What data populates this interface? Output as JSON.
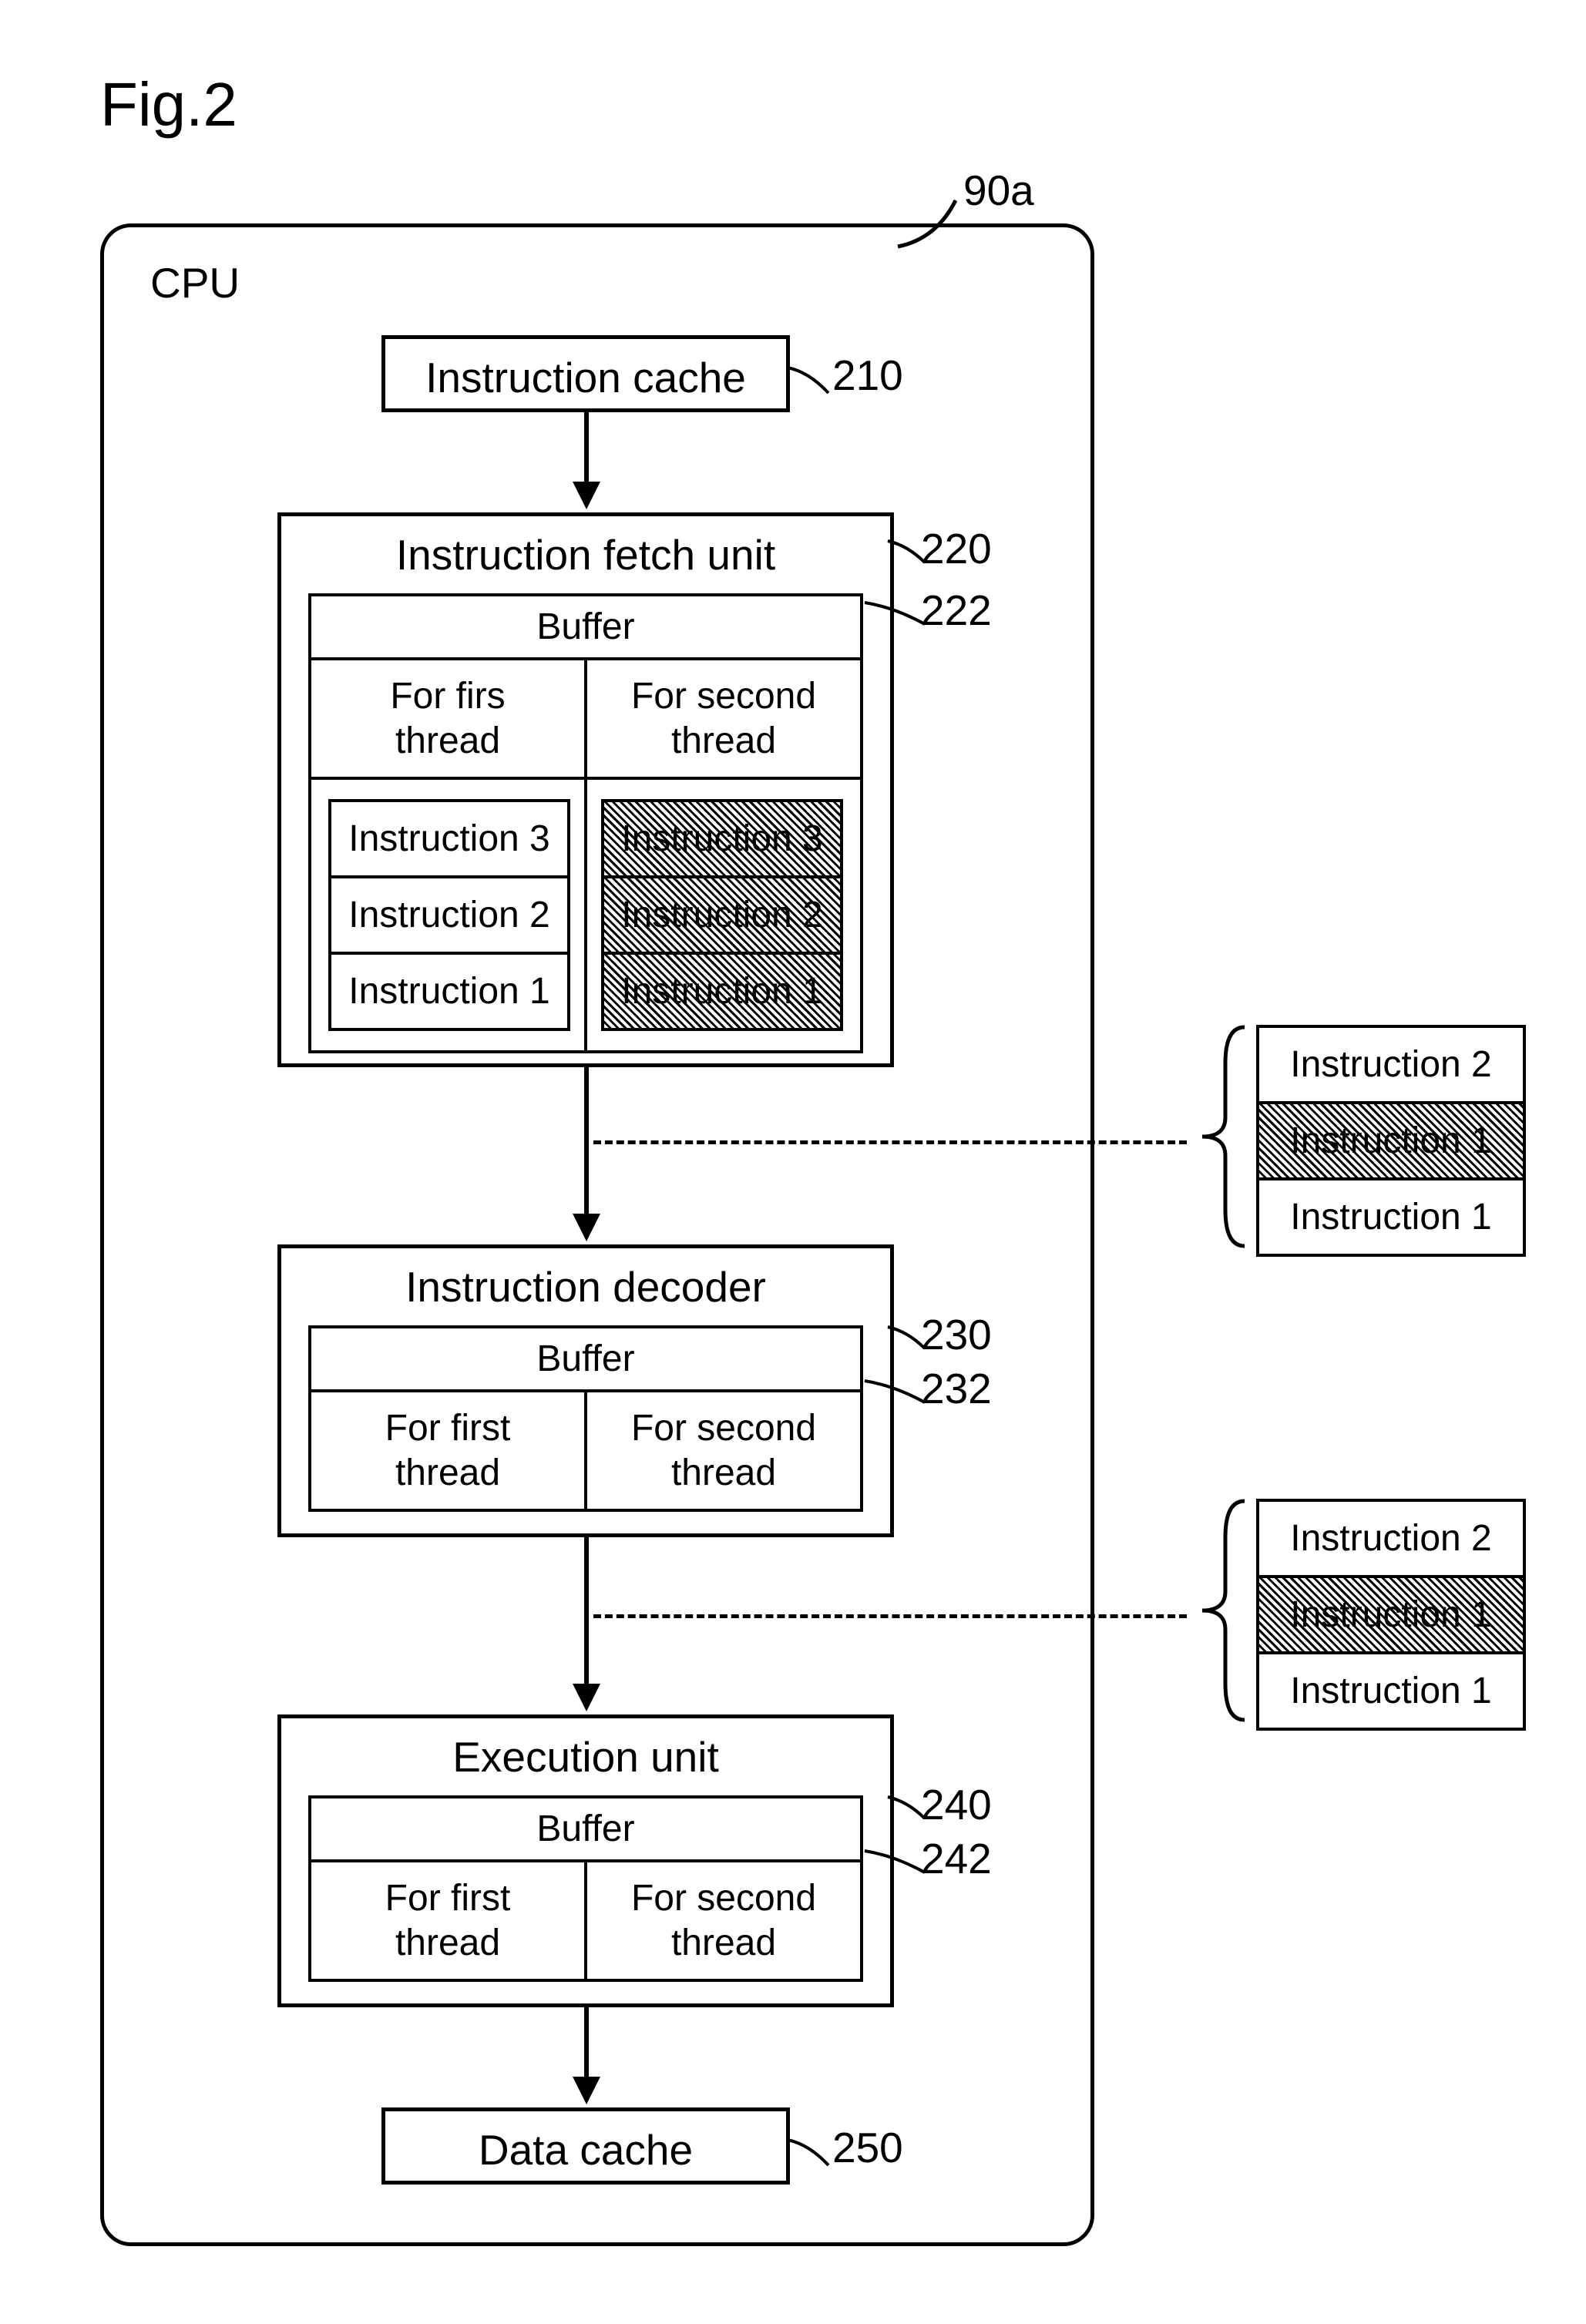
{
  "fig_label": "Fig.2",
  "cpu_label": "CPU",
  "ref_90a": "90a",
  "instruction_cache": {
    "title": "Instruction cache",
    "ref": "210"
  },
  "fetch_unit": {
    "title": "Instruction fetch unit",
    "ref": "220",
    "buffer_title": "Buffer",
    "buffer_ref": "222",
    "col1_title_line1": "For firs",
    "col1_title_line2": "thread",
    "col2_title_line1": "For second",
    "col2_title_line2": "thread",
    "col1_instr": [
      "Instruction 3",
      "Instruction 2",
      "Instruction 1"
    ],
    "col2_instr": [
      "Instruction 3",
      "Instruction 2",
      "Instruction 1"
    ]
  },
  "decoder": {
    "title": "Instruction decoder",
    "ref": "230",
    "buffer_title": "Buffer",
    "buffer_ref": "232",
    "col1_line1": "For first",
    "col1_line2": "thread",
    "col2_line1": "For second",
    "col2_line2": "thread"
  },
  "execution": {
    "title": "Execution unit",
    "ref": "240",
    "buffer_title": "Buffer",
    "buffer_ref": "242",
    "col1_line1": "For first",
    "col1_line2": "thread",
    "col2_line1": "For second",
    "col2_line2": "thread"
  },
  "data_cache": {
    "title": "Data cache",
    "ref": "250"
  },
  "side_stack_1": [
    "Instruction 2",
    "Instruction 1",
    "Instruction 1"
  ],
  "side_stack_2": [
    "Instruction 2",
    "Instruction 1",
    "Instruction 1"
  ]
}
